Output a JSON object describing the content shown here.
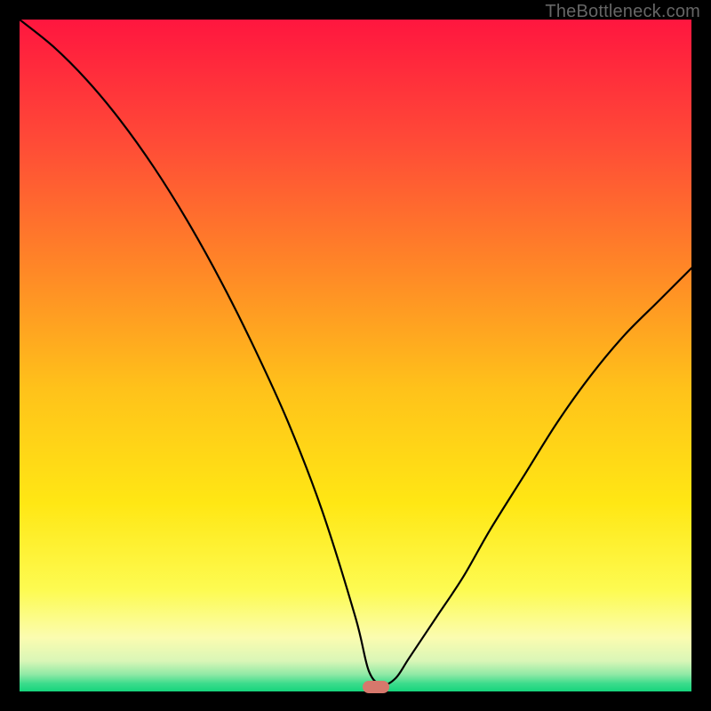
{
  "watermark": "TheBottleneck.com",
  "chart_data": {
    "type": "line",
    "title": "",
    "xlabel": "",
    "ylabel": "",
    "xlim": [
      0,
      100
    ],
    "ylim": [
      0,
      100
    ],
    "grid": false,
    "legend": false,
    "bottleneck_x": 53,
    "series": [
      {
        "name": "bottleneck-curve",
        "color": "#000000",
        "x": [
          0,
          5,
          10,
          15,
          20,
          25,
          30,
          35,
          40,
          45,
          50,
          52,
          54,
          56,
          58,
          62,
          66,
          70,
          75,
          80,
          85,
          90,
          95,
          100
        ],
        "y": [
          100,
          96,
          91,
          85,
          78,
          70,
          61,
          51,
          40,
          27,
          11,
          3,
          1,
          2,
          5,
          11,
          17,
          24,
          32,
          40,
          47,
          53,
          58,
          63
        ]
      }
    ],
    "marker": {
      "color": "#d6786c",
      "x": 53,
      "y": 0.6
    },
    "background_gradient": {
      "stops": [
        {
          "pos": 0.0,
          "color": "#ff163f"
        },
        {
          "pos": 0.18,
          "color": "#ff4a37"
        },
        {
          "pos": 0.38,
          "color": "#ff8a26"
        },
        {
          "pos": 0.55,
          "color": "#ffc21a"
        },
        {
          "pos": 0.72,
          "color": "#ffe714"
        },
        {
          "pos": 0.85,
          "color": "#fdfb52"
        },
        {
          "pos": 0.92,
          "color": "#fbfcb0"
        },
        {
          "pos": 0.955,
          "color": "#d9f6b7"
        },
        {
          "pos": 0.975,
          "color": "#8ee9a5"
        },
        {
          "pos": 0.988,
          "color": "#3ddc8c"
        },
        {
          "pos": 1.0,
          "color": "#16d47c"
        }
      ]
    }
  }
}
